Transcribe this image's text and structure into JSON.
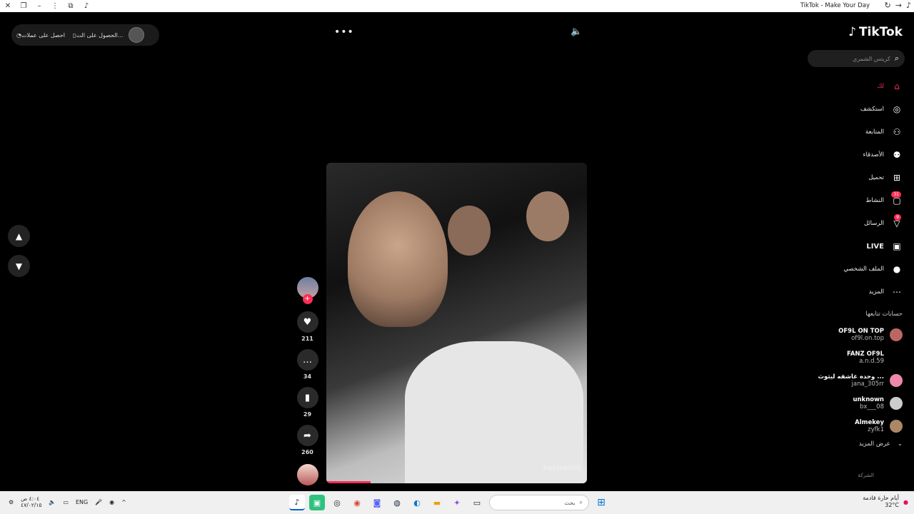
{
  "window": {
    "title": "TikTok - Make Your Day"
  },
  "top_left": {
    "coins_label": "احصل على عملات",
    "app_label": "الحصول على الت..."
  },
  "player": {
    "more_icon": "more-horizontal-icon",
    "volume_icon": "volume-icon",
    "watermark": "hasssaniiii",
    "progress": 0.17
  },
  "actions": {
    "likes": "211",
    "comments": "34",
    "saves": "29",
    "shares": "260"
  },
  "sidebar": {
    "logo": "TikTok",
    "search_placeholder": "كريتس الشمري",
    "menu": [
      {
        "label": "لك",
        "icon": "home-icon",
        "active": true
      },
      {
        "label": "استكشف",
        "icon": "compass-icon"
      },
      {
        "label": "المتابعة",
        "icon": "user-follow-icon"
      },
      {
        "label": "الأصدقاء",
        "icon": "friends-icon"
      },
      {
        "label": "تحميل",
        "icon": "upload-icon"
      },
      {
        "label": "النشاط",
        "icon": "activity-icon",
        "badge": "31"
      },
      {
        "label": "الرسائل",
        "icon": "messages-icon",
        "badge": "9"
      },
      {
        "label": "LIVE",
        "icon": "live-icon"
      },
      {
        "label": "الملف الشخصي",
        "icon": "profile-icon"
      },
      {
        "label": "المزيد",
        "icon": "more-icon"
      }
    ],
    "following_header": "حسابات تتابعها",
    "accounts": [
      {
        "name": "OF9L ON TOP",
        "handle": "of9l.on.top"
      },
      {
        "name": "FANZ OF9L",
        "handle": "a.n.d.59"
      },
      {
        "name": "وحده عاشقه ليثوث ...",
        "handle": "jana_305rr"
      },
      {
        "name": "unknown",
        "handle": "bx___08"
      },
      {
        "name": "Almekey",
        "handle": "zyfk1"
      }
    ],
    "see_more": "عرض المزيد",
    "company": "الشركة"
  },
  "taskbar": {
    "time": "٤:٠٤ ص",
    "date": "٤٧/٠٢/١٥",
    "lang": "ENG",
    "search_label": "بحث",
    "weather_line1": "أيام حارة قادمة",
    "weather_line2": "32°C"
  },
  "colors": {
    "accent": "#fe2c55",
    "background": "#000000"
  }
}
